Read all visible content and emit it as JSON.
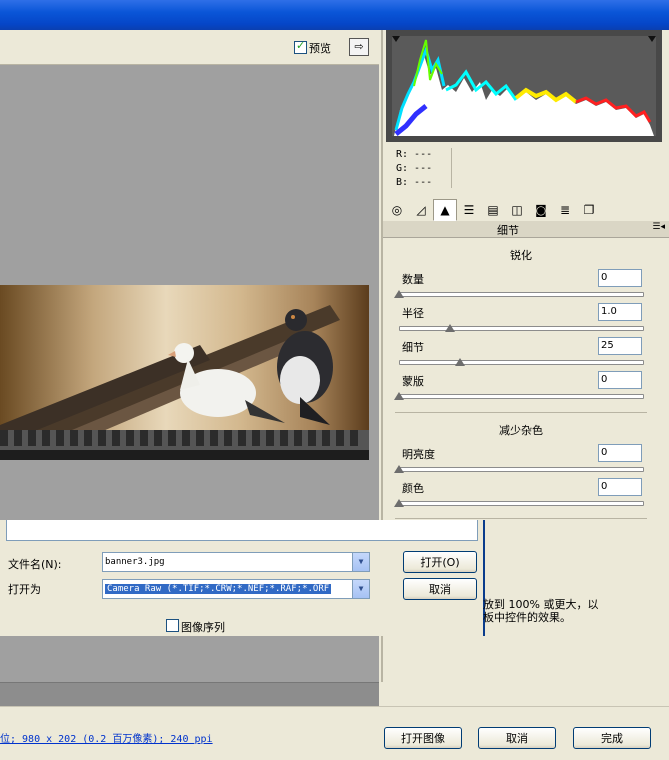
{
  "toolbar": {
    "preview_label": "预览"
  },
  "histogram": {
    "r": "R: ---",
    "g": "G: ---",
    "b": "B: ---"
  },
  "tabs": [
    {
      "icon": "aperture-icon"
    },
    {
      "icon": "curve-icon"
    },
    {
      "icon": "detail-triangle-icon",
      "active": true
    },
    {
      "icon": "hsl-icon"
    },
    {
      "icon": "split-toning-icon"
    },
    {
      "icon": "lens-icon"
    },
    {
      "icon": "camera-icon"
    },
    {
      "icon": "presets-icon"
    },
    {
      "icon": "snapshots-icon"
    }
  ],
  "panel": {
    "title": "细节",
    "sharpen_title": "锐化",
    "noise_title": "减少杂色",
    "sliders": [
      {
        "label": "数量",
        "value": "0",
        "level": 0
      },
      {
        "label": "半径",
        "value": "1.0",
        "level": 0.21
      },
      {
        "label": "细节",
        "value": "25",
        "level": 0.25
      },
      {
        "label": "蒙版",
        "value": "0",
        "level": 0
      },
      {
        "label": "明亮度",
        "value": "0",
        "level": 0
      },
      {
        "label": "颜色",
        "value": "0",
        "level": 0
      }
    ]
  },
  "dialog": {
    "filename_label": "文件名(N):",
    "filename_value": "banner3.jpg",
    "openas_label": "打开为",
    "openas_value": "Camera Raw (*.TIF;*.CRW;*.NEF;*.RAF;*.ORF",
    "open_button": "打开(O)",
    "cancel_button": "取消",
    "sequence_label": "图像序列"
  },
  "cover_text": [
    "放到 100% 或更大，以",
    "板中控件的效果。"
  ],
  "status": {
    "link_text": "位; 980 x 202 (0.2 百万像素); 240 ppi",
    "open_image": "打开图像",
    "cancel": "取消",
    "done": "完成"
  }
}
